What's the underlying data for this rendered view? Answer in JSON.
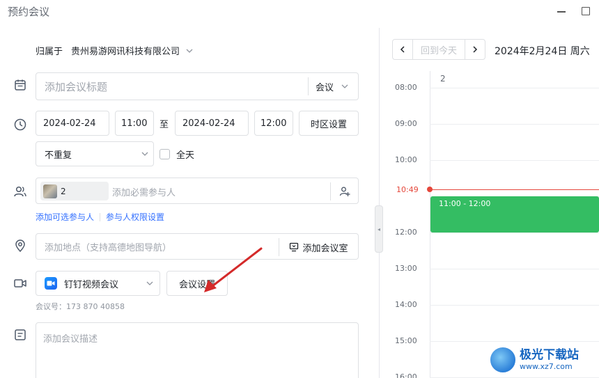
{
  "window": {
    "title": "预约会议"
  },
  "form": {
    "belong_label": "归属于",
    "organization": "贵州易游网讯科技有限公司",
    "title_placeholder": "添加会议标题",
    "type_value": "会议",
    "start_date": "2024-02-24",
    "start_time": "11:00",
    "to_label": "至",
    "end_date": "2024-02-24",
    "end_time": "12:00",
    "timezone_button": "时区设置",
    "repeat_value": "不重复",
    "allday_label": "全天",
    "participant_count": "2",
    "participants_placeholder": "添加必需参与人",
    "add_optional_link": "添加可选参与人",
    "permissions_link": "参与人权限设置",
    "location_placeholder": "添加地点（支持高德地图导航）",
    "add_room_button": "添加会议室",
    "video_value": "钉钉视频会议",
    "meeting_settings_button": "会议设置",
    "meeting_id": "会议号：173 870 40858",
    "description_placeholder": "添加会议描述"
  },
  "calendar": {
    "today_button": "回到今天",
    "date_heading": "2024年2月24日 周六",
    "day_column": "2",
    "hours": [
      "08:00",
      "09:00",
      "10:00",
      "12:00",
      "13:00",
      "14:00",
      "15:00",
      "16:00"
    ],
    "now_time": "10:49",
    "event_time": "11:00 - 12:00"
  },
  "watermark": {
    "name": "极光下载站",
    "url": "www.xz7.com"
  },
  "colors": {
    "accent": "#3370ff",
    "event": "#34bd63",
    "now": "#e5473b"
  }
}
